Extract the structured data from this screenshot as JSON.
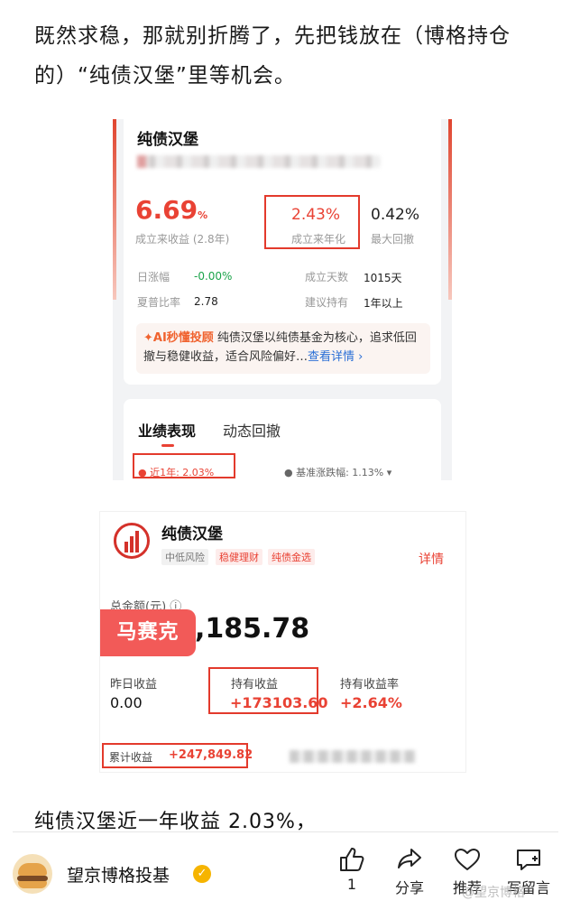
{
  "intro_text": "既然求稳，那就别折腾了，先把钱放在（博格持仓的）“纯债汉堡”里等机会。",
  "shot1": {
    "title": "纯债汉堡",
    "return_value": "6.69",
    "return_unit": "%",
    "return_label": "成立来收益 (2.8年)",
    "annual_value": "2.43%",
    "annual_label": "成立来年化",
    "drawdown_value": "0.42%",
    "drawdown_label": "最大回撤",
    "rows": {
      "daily_label": "日涨幅",
      "daily_value": "-0.00%",
      "days_label": "成立天数",
      "days_value": "1015天",
      "sharpe_label": "夏普比率",
      "sharpe_value": "2.78",
      "hold_label": "建议持有",
      "hold_value": "1年以上"
    },
    "ai_tag": "✦AI秒懂投顾",
    "ai_text": " 纯债汉堡以纯债基金为核心，追求低回撤与稳健收益，适合风险偏好…",
    "ai_link": "查看详情 ›",
    "tabs": [
      "业绩表现",
      "动态回撤"
    ],
    "perf_left": "● 近1年: 2.03%",
    "perf_right": "● 基准涨跌幅: 1.13% ▾"
  },
  "shot2": {
    "title": "纯债汉堡",
    "tags": [
      "中低风险",
      "稳健理财",
      "纯债金选"
    ],
    "detail": "详情",
    "total_label": "总金额(元) ⓘ",
    "total_value": ",185.78",
    "mask_label": "马赛克",
    "y_label": "昨日收益",
    "y_value": "0.00",
    "hold_label": "持有收益",
    "hold_value": "+173103.60",
    "rate_label": "持有收益率",
    "rate_value": "+2.64%",
    "cum_label": "累计收益",
    "cum_value": "+247,849.82"
  },
  "summary_text": "纯债汉堡近一年收益 2.03%，",
  "author": "望京博格投基",
  "actions": [
    {
      "icon": "like-icon",
      "label": "1"
    },
    {
      "icon": "share-icon",
      "label": "分享"
    },
    {
      "icon": "heart-icon",
      "label": "推荐"
    },
    {
      "icon": "comment-icon",
      "label": "写留言"
    }
  ],
  "watermark": "@望京博格"
}
